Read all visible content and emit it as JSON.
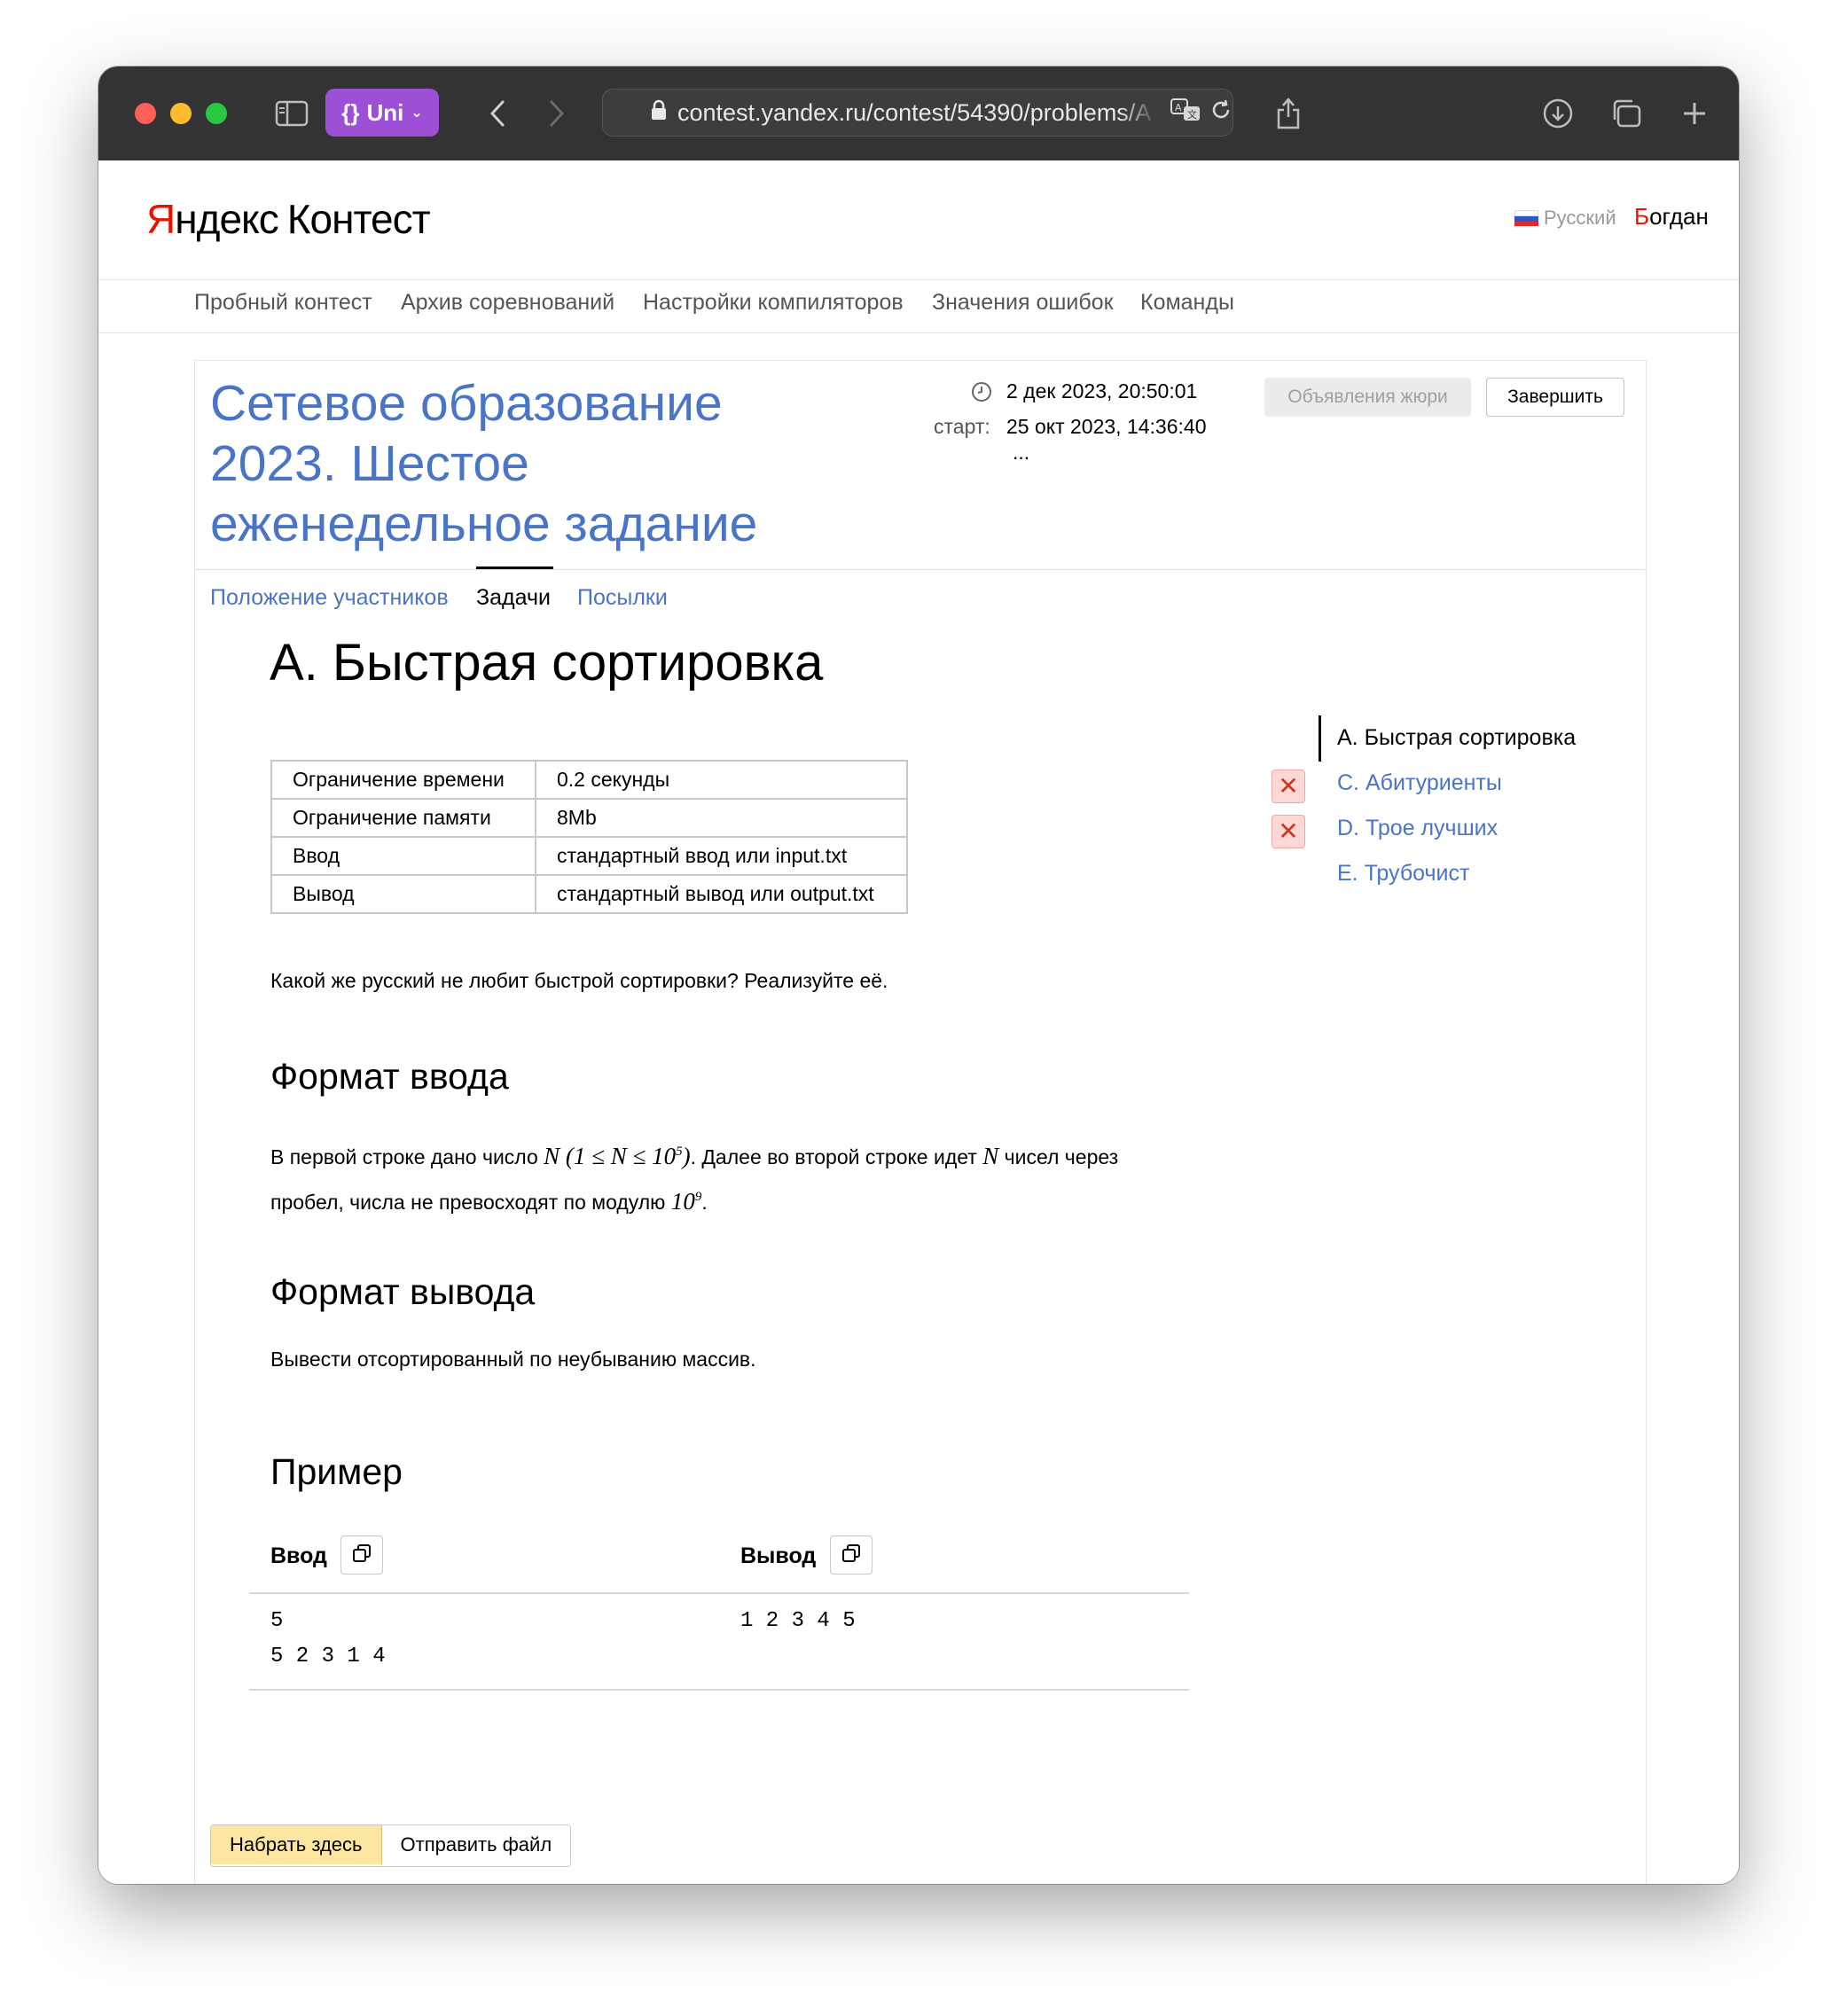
{
  "browser": {
    "sidebar_toggle_icon": "sidebar-icon",
    "extension_label": "Uni",
    "extension_icon": "braces-icon",
    "url": "contest.yandex.ru/contest/54390/problems/A",
    "icons": [
      "back-icon",
      "forward-icon",
      "lock-icon",
      "translate-icon",
      "reload-icon",
      "share-icon",
      "download-icon",
      "tabs-icon",
      "plus-icon"
    ]
  },
  "header": {
    "logo_brand": "Яндекс",
    "logo_product": "Контест",
    "language": "Русский",
    "user_name_first": "Б",
    "user_name_rest": "огдан"
  },
  "nav": {
    "items": [
      "Пробный контест",
      "Архив соревнований",
      "Настройки компиляторов",
      "Значения ошибок",
      "Команды"
    ]
  },
  "contest": {
    "title_lines": [
      "Сетевое образование",
      "2023. Шестое",
      "еженедельное задание"
    ],
    "time_now": "2 дек 2023, 20:50:01",
    "start_label": "старт:",
    "start_time": "25 окт 2023, 14:36:40",
    "ellipsis": "...",
    "announce_button": "Объявления жюри",
    "finish_button": "Завершить"
  },
  "tabs": [
    "Положение участников",
    "Задачи",
    "Посылки"
  ],
  "problem": {
    "title": "A. Быстрая сортировка",
    "limits": [
      {
        "key": "Ограничение времени",
        "value": "0.2 секунды"
      },
      {
        "key": "Ограничение памяти",
        "value": "8Mb"
      },
      {
        "key": "Ввод",
        "value": "стандартный ввод или input.txt"
      },
      {
        "key": "Вывод",
        "value": "стандартный вывод или output.txt"
      }
    ],
    "statement": "Какой же русский не любит быстрой сортировки? Реализуйте её.",
    "input_heading": "Формат ввода",
    "input_text_1": "В первой строке дано число",
    "input_math_1": "N (1 ≤ N ≤ 10",
    "input_math_1_sup": "5",
    "input_math_1_close": ")",
    "input_text_2": ". Далее во второй строке идет",
    "input_math_2": "N",
    "input_text_3": "чисел через",
    "input_text_4": "пробел, числа не превосходят по модулю",
    "input_math_3": "10",
    "input_math_3_sup": "9",
    "input_text_5": ".",
    "output_heading": "Формат вывода",
    "output_text": "Вывести отсортированный по неубыванию массив.",
    "example_heading": "Пример",
    "example_input_label": "Ввод",
    "example_output_label": "Вывод",
    "example_input": "5\n5 2 3 1 4",
    "example_output": "1 2 3 4 5"
  },
  "sidebar": {
    "problems": [
      {
        "label": "A. Быстрая сортировка",
        "status": "current"
      },
      {
        "label": "C. Абитуриенты",
        "status": "failed"
      },
      {
        "label": "D. Трое лучших",
        "status": "failed"
      },
      {
        "label": "E. Трубочист",
        "status": "none"
      }
    ]
  },
  "submit": {
    "type_here": "Набрать здесь",
    "send_file": "Отправить файл"
  },
  "colors": {
    "link": "#4a75c7",
    "brand_red": "#e61400",
    "fail_badge": "#fdd8d5",
    "primary_button": "#fde7a0"
  }
}
